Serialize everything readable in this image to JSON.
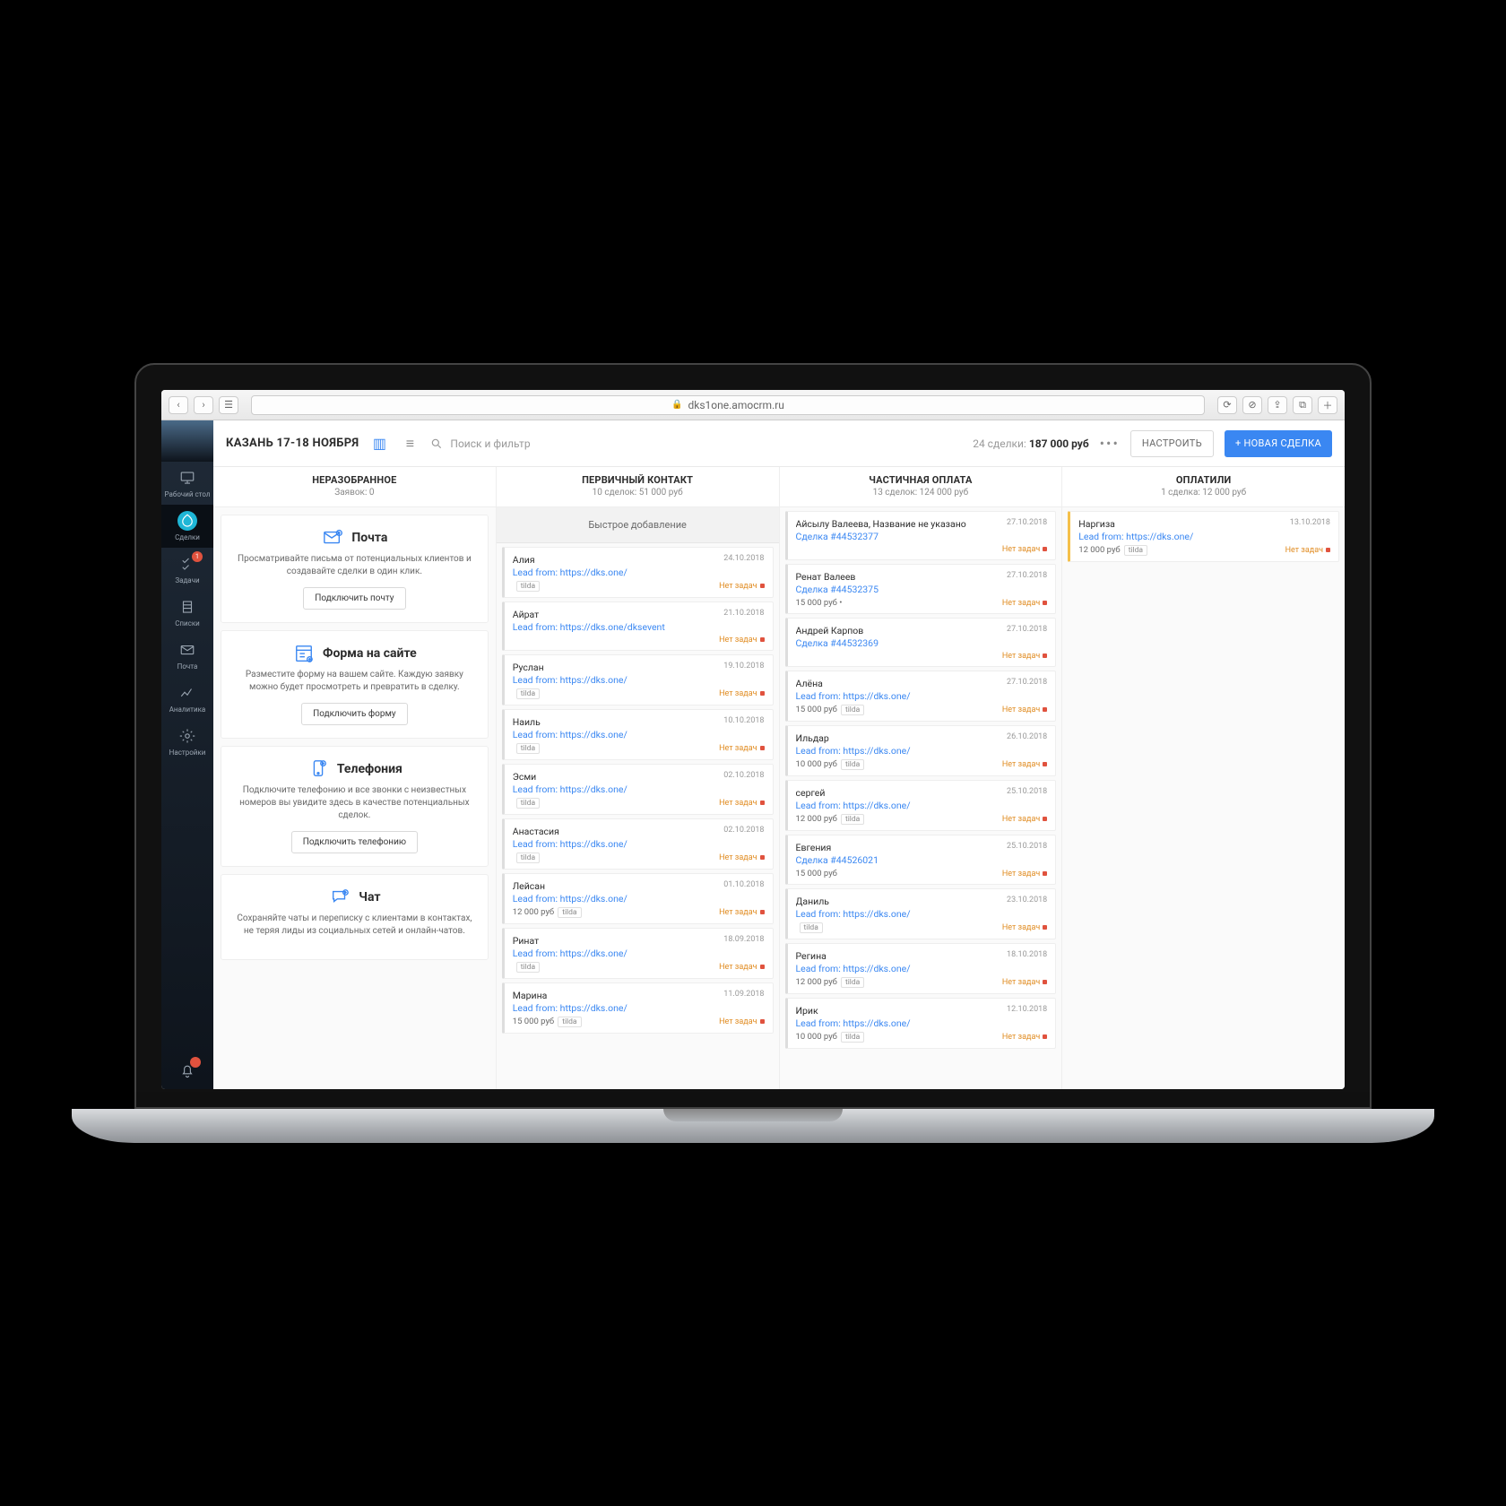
{
  "browser": {
    "url": "dks1one.amocrm.ru"
  },
  "sidebar": {
    "items": [
      {
        "label": "Рабочий стол"
      },
      {
        "label": "Сделки"
      },
      {
        "label": "Задачи",
        "badge": "1"
      },
      {
        "label": "Списки"
      },
      {
        "label": "Почта"
      },
      {
        "label": "Аналитика"
      },
      {
        "label": "Настройки"
      }
    ]
  },
  "topbar": {
    "pipeline": "КАЗАНЬ 17-18 НОЯБРЯ",
    "search_placeholder": "Поиск и фильтр",
    "summary_count": "24 сделки:",
    "summary_amount": "187 000 руб",
    "settings": "НАСТРОИТЬ",
    "new_lead": "+ НОВАЯ СДЕЛКА"
  },
  "columns": {
    "c0": {
      "title": "НЕРАЗОБРАННОЕ",
      "sub": "Заявок: 0"
    },
    "c1": {
      "title": "ПЕРВИЧНЫЙ КОНТАКТ",
      "sub": "10 сделок: 51 000 руб",
      "quick": "Быстрое добавление"
    },
    "c2": {
      "title": "ЧАСТИЧНАЯ ОПЛАТА",
      "sub": "13 сделок: 124 000 руб"
    },
    "c3": {
      "title": "ОПЛАТИЛИ",
      "sub": "1 сделка: 12 000 руб"
    }
  },
  "promos": {
    "p0": {
      "title": "Почта",
      "desc": "Просматривайте письма от потенциальных клиентов и создавайте сделки в один клик.",
      "btn": "Подключить почту"
    },
    "p1": {
      "title": "Форма на сайте",
      "desc": "Разместите форму на вашем сайте. Каждую заявку можно будет просмотреть и превратить в сделку.",
      "btn": "Подключить форму"
    },
    "p2": {
      "title": "Телефония",
      "desc": "Подключите телефонию и все звонки с неизвестных номеров вы увидите здесь в качестве потенциальных сделок.",
      "btn": "Подключить телефонию"
    },
    "p3": {
      "title": "Чат",
      "desc": "Сохраняйте чаты и переписку с клиентами в контактах, не теряя лиды из социальных сетей и онлайн-чатов."
    }
  },
  "labels": {
    "no_task": "Нет задач",
    "lead_from": "Lead from: https://dks.one/",
    "lead_from_event": "Lead from: https://dks.one/dksevent",
    "tilda": "tilda"
  },
  "cards": {
    "col1": [
      {
        "name": "Алия",
        "date": "24.10.2018",
        "link": "lead_from",
        "price": "",
        "tag": "tilda"
      },
      {
        "name": "Айрат",
        "date": "21.10.2018",
        "link": "lead_from_event",
        "price": "",
        "tag": ""
      },
      {
        "name": "Руслан",
        "date": "19.10.2018",
        "link": "lead_from",
        "price": "",
        "tag": "tilda"
      },
      {
        "name": "Наиль",
        "date": "10.10.2018",
        "link": "lead_from",
        "price": "",
        "tag": "tilda"
      },
      {
        "name": "Эсми",
        "date": "02.10.2018",
        "link": "lead_from",
        "price": "",
        "tag": "tilda"
      },
      {
        "name": "Анастасия",
        "date": "02.10.2018",
        "link": "lead_from",
        "price": "",
        "tag": "tilda"
      },
      {
        "name": "Лейсан",
        "date": "01.10.2018",
        "link": "lead_from",
        "price": "12 000 руб",
        "tag": "tilda"
      },
      {
        "name": "Ринат",
        "date": "18.09.2018",
        "link": "lead_from",
        "price": "",
        "tag": "tilda"
      },
      {
        "name": "Марина",
        "date": "11.09.2018",
        "link": "lead_from",
        "price": "15 000 руб",
        "tag": "tilda"
      }
    ],
    "col2": [
      {
        "name": "Айсылу Валеева, Название не указано",
        "date": "27.10.2018",
        "deal": "Сделка #44532377",
        "price": "",
        "tag": ""
      },
      {
        "name": "Ренат Валеев",
        "date": "27.10.2018",
        "deal": "Сделка #44532375",
        "price": "15 000 руб  •",
        "tag": ""
      },
      {
        "name": "Андрей Карпов",
        "date": "27.10.2018",
        "deal": "Сделка #44532369",
        "price": "",
        "tag": ""
      },
      {
        "name": "Алёна",
        "date": "27.10.2018",
        "link": "lead_from",
        "price": "15 000 руб",
        "tag": "tilda"
      },
      {
        "name": "Ильдар",
        "date": "26.10.2018",
        "link": "lead_from",
        "price": "10 000 руб",
        "tag": "tilda"
      },
      {
        "name": "сергей",
        "date": "25.10.2018",
        "link": "lead_from",
        "price": "12 000 руб",
        "tag": "tilda"
      },
      {
        "name": "Евгения",
        "date": "25.10.2018",
        "deal": "Сделка #44526021",
        "price": "15 000 руб",
        "tag": ""
      },
      {
        "name": "Даниль",
        "date": "23.10.2018",
        "link": "lead_from",
        "price": "",
        "tag": "tilda"
      },
      {
        "name": "Регина",
        "date": "18.10.2018",
        "link": "lead_from",
        "price": "12 000 руб",
        "tag": "tilda"
      },
      {
        "name": "Ирик",
        "date": "12.10.2018",
        "link": "lead_from",
        "price": "10 000 руб",
        "tag": "tilda"
      }
    ],
    "col3": [
      {
        "name": "Наргиза",
        "date": "13.10.2018",
        "link": "lead_from",
        "price": "12 000 руб",
        "tag": "tilda"
      }
    ]
  }
}
